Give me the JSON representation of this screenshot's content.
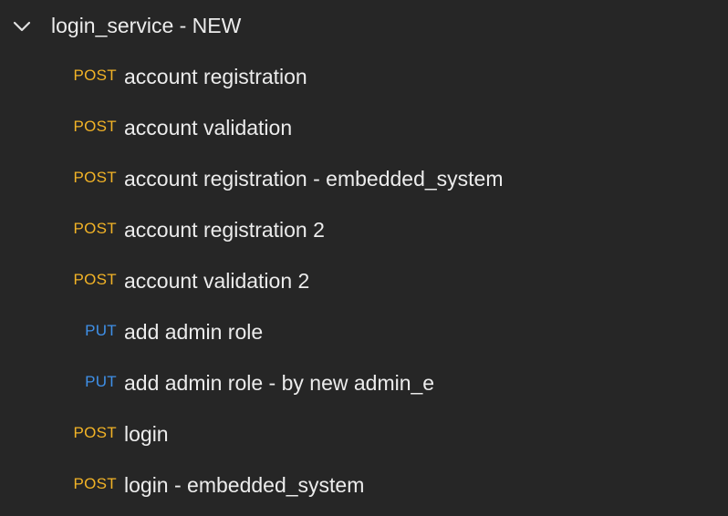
{
  "collection": {
    "folder": {
      "name": "login_service - NEW",
      "expanded": true,
      "icon": "chevron-down-icon"
    },
    "requests": [
      {
        "method": "POST",
        "name": "account registration"
      },
      {
        "method": "POST",
        "name": "account validation"
      },
      {
        "method": "POST",
        "name": "account registration - embedded_system"
      },
      {
        "method": "POST",
        "name": "account registration 2"
      },
      {
        "method": "POST",
        "name": "account validation 2"
      },
      {
        "method": "PUT",
        "name": "add admin role"
      },
      {
        "method": "PUT",
        "name": "add admin role - by new admin_e"
      },
      {
        "method": "POST",
        "name": "login"
      },
      {
        "method": "POST",
        "name": "login - embedded_system"
      }
    ]
  },
  "colors": {
    "background": "#262626",
    "text": "#ececec",
    "post": "#f2b326",
    "put": "#3f90e8"
  }
}
